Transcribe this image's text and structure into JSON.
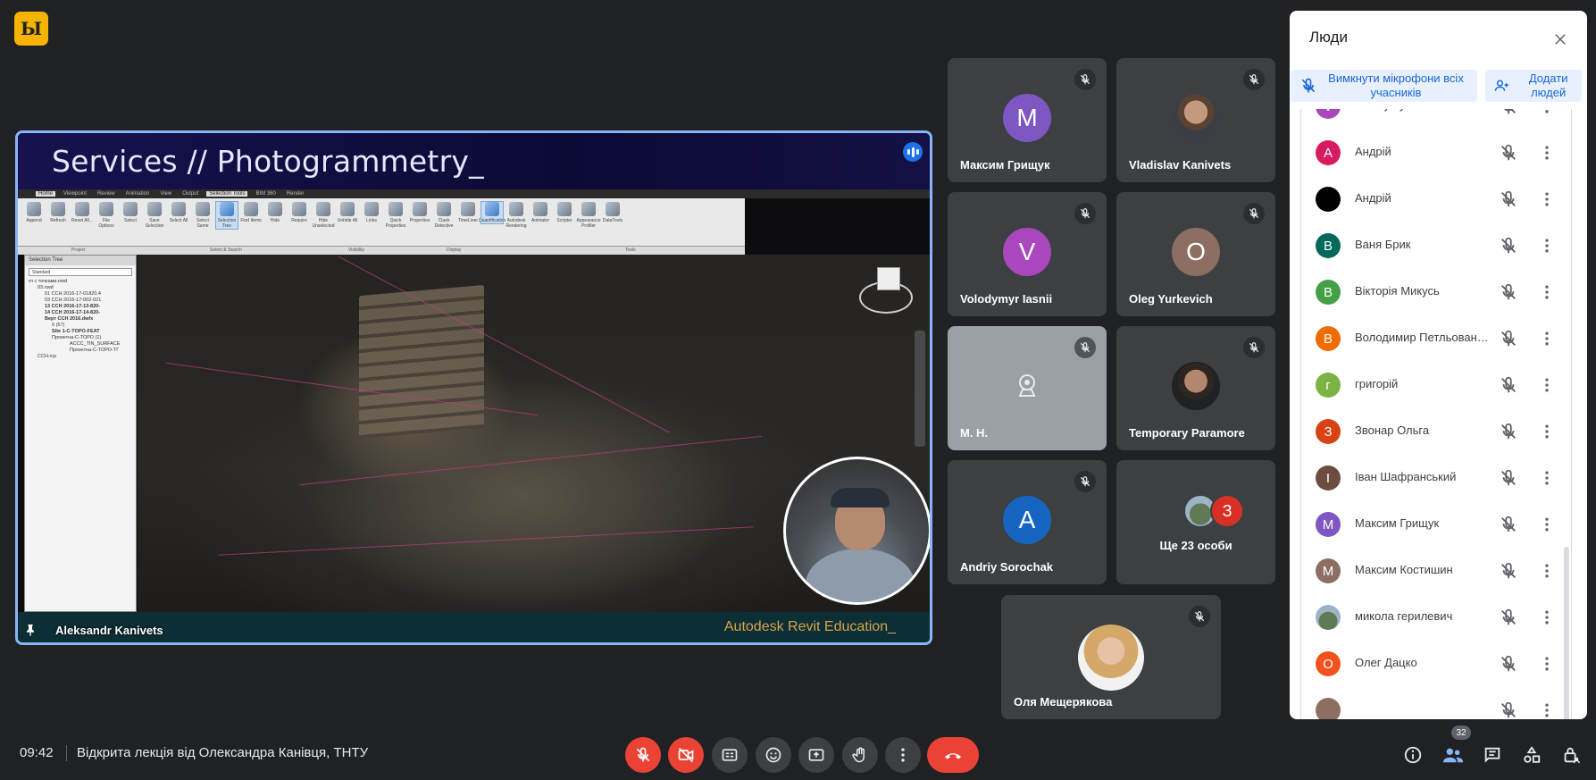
{
  "logo": {
    "glyph": "Ы"
  },
  "presentation": {
    "slide_title": "Services // Photogrammetry_",
    "ribbon_tabs": [
      "Home",
      "Viewpoint",
      "Review",
      "Animation",
      "View",
      "Output",
      "Selection Tools",
      "BIM 360",
      "Render"
    ],
    "ribbon_buttons": [
      "Append",
      "Refresh",
      "Reset All...",
      "File Options",
      "Select",
      "Save Selection",
      "Select All",
      "Select Same",
      "Selection Tree",
      "Find Items",
      "Hide",
      "Require",
      "Hide Unselected",
      "Unhide All",
      "Links",
      "Quick Properties",
      "Properties",
      "Clash Detective",
      "TimeLiner",
      "Quantification",
      "Autodesk Rendering",
      "Animator",
      "Scripter",
      "Appearance Profiler",
      "DataTools"
    ],
    "ribbon_groups": [
      "Project",
      "Select & Search",
      "Visibility",
      "Display",
      "Tools"
    ],
    "tree_title": "Selection Tree",
    "tree_mode": "Standard",
    "tree_items": [
      "гп с точками.nwd",
      "03.nwd",
      "01 ССН 2016-17-01820.4",
      "03 ССН 2016-17-002-021",
      "13 ССН 2016-17-13-820-",
      "14 ССН 2016-17-14-820-",
      "Верт ССН 2016.dwfx",
      "0 (57)",
      "Site 1-C-TOPO-FEAT",
      "Проектна-С-ТОРО (1)",
      "ACCC_TIN_SURFACE",
      "Проектна-С-ТОРО-ТГ",
      "ССН.rcp"
    ],
    "footer_brand": "Autodesk Revit Education_",
    "presenter_name": "Aleksandr Kanivets"
  },
  "tiles": [
    {
      "name": "Максим Грищук",
      "initial": "M",
      "color": "#7e57c2",
      "type": "initial"
    },
    {
      "name": "Vladislav Kanivets",
      "type": "photo"
    },
    {
      "name": "Volodymyr Iasnii",
      "initial": "V",
      "color": "#ab47bc",
      "type": "initial"
    },
    {
      "name": "Oleg Yurkevich",
      "initial": "O",
      "color": "#8d6e63",
      "type": "initial"
    },
    {
      "name": "М. Н.",
      "type": "camera"
    },
    {
      "name": "Temporary Paramore",
      "type": "photo"
    },
    {
      "name": "Andriy Sorochak",
      "initial": "A",
      "color": "#1565c0",
      "type": "initial"
    },
    {
      "name": "Ще 23 особи",
      "initial": "З",
      "type": "more"
    },
    {
      "name": "Оля Мещерякова",
      "type": "photo"
    }
  ],
  "people_panel": {
    "title": "Люди",
    "mute_all_label": "Вимкнути мікрофони всіх учасників",
    "add_people_label": "Додати людей",
    "people": [
      {
        "name": "Volodymyr Iasnii",
        "initial": "V",
        "color": "#ab47bc"
      },
      {
        "name": "Андрій",
        "initial": "А",
        "color": "#d81b60"
      },
      {
        "name": "Андрій",
        "initial": "",
        "color": "#000000"
      },
      {
        "name": "Ваня Брик",
        "initial": "В",
        "color": "#00695c"
      },
      {
        "name": "Вікторія Микусь",
        "initial": "В",
        "color": "#43a047"
      },
      {
        "name": "Володимир Петльованый",
        "initial": "В",
        "color": "#ef6c00"
      },
      {
        "name": "григорій",
        "initial": "г",
        "color": "#7cb342"
      },
      {
        "name": "Звонар Ольга",
        "initial": "З",
        "color": "#d84315"
      },
      {
        "name": "Іван Шафранський",
        "initial": "І",
        "color": "#6d4c41"
      },
      {
        "name": "Максим Грищук",
        "initial": "М",
        "color": "#7e57c2"
      },
      {
        "name": "Максим Костишин",
        "initial": "М",
        "color": "#8d6e63"
      },
      {
        "name": "микола герилевич",
        "initial": "",
        "color": "#6b8e5a"
      },
      {
        "name": "Олег Дацко",
        "initial": "О",
        "color": "#f4511e"
      },
      {
        "name": "",
        "initial": "",
        "color": "#8d6e63"
      }
    ]
  },
  "bottom_bar": {
    "time": "09:42",
    "meeting_title": "Відкрита лекція від Олександра Канівця, ТНТУ",
    "participant_count": "32"
  }
}
